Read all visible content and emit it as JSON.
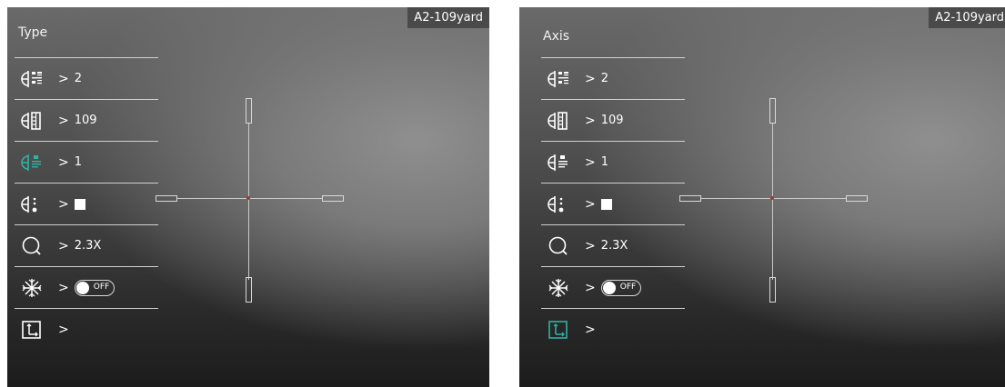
{
  "colors": {
    "accent": "#2fb3a3",
    "menu_text": "#ffffff",
    "divider": "#d0d0d0",
    "badge_bg": "#4a4a4a",
    "center_dot": "#9b3b3b"
  },
  "panels": [
    {
      "title": "Type",
      "badge": "A2-109yard",
      "highlighted_item": "zero-type",
      "items": [
        {
          "icon": "reticle-profile-icon",
          "value": "2"
        },
        {
          "icon": "zero-distance-icon",
          "value": "109"
        },
        {
          "icon": "reticle-type-icon",
          "value": "1"
        },
        {
          "icon": "reticle-color-icon",
          "value": "■"
        },
        {
          "icon": "zoom-icon",
          "value": "2.3X"
        },
        {
          "icon": "freeze-icon",
          "value": "OFF"
        },
        {
          "icon": "axis-icon",
          "value": ""
        }
      ]
    },
    {
      "title": "Axis",
      "badge": "A2-109yard",
      "highlighted_item": "axis",
      "items": [
        {
          "icon": "reticle-profile-icon",
          "value": "2"
        },
        {
          "icon": "zero-distance-icon",
          "value": "109"
        },
        {
          "icon": "reticle-type-icon",
          "value": "1"
        },
        {
          "icon": "reticle-color-icon",
          "value": "■"
        },
        {
          "icon": "zoom-icon",
          "value": "2.3X"
        },
        {
          "icon": "freeze-icon",
          "value": "OFF"
        },
        {
          "icon": "axis-icon",
          "value": ""
        }
      ]
    }
  ]
}
